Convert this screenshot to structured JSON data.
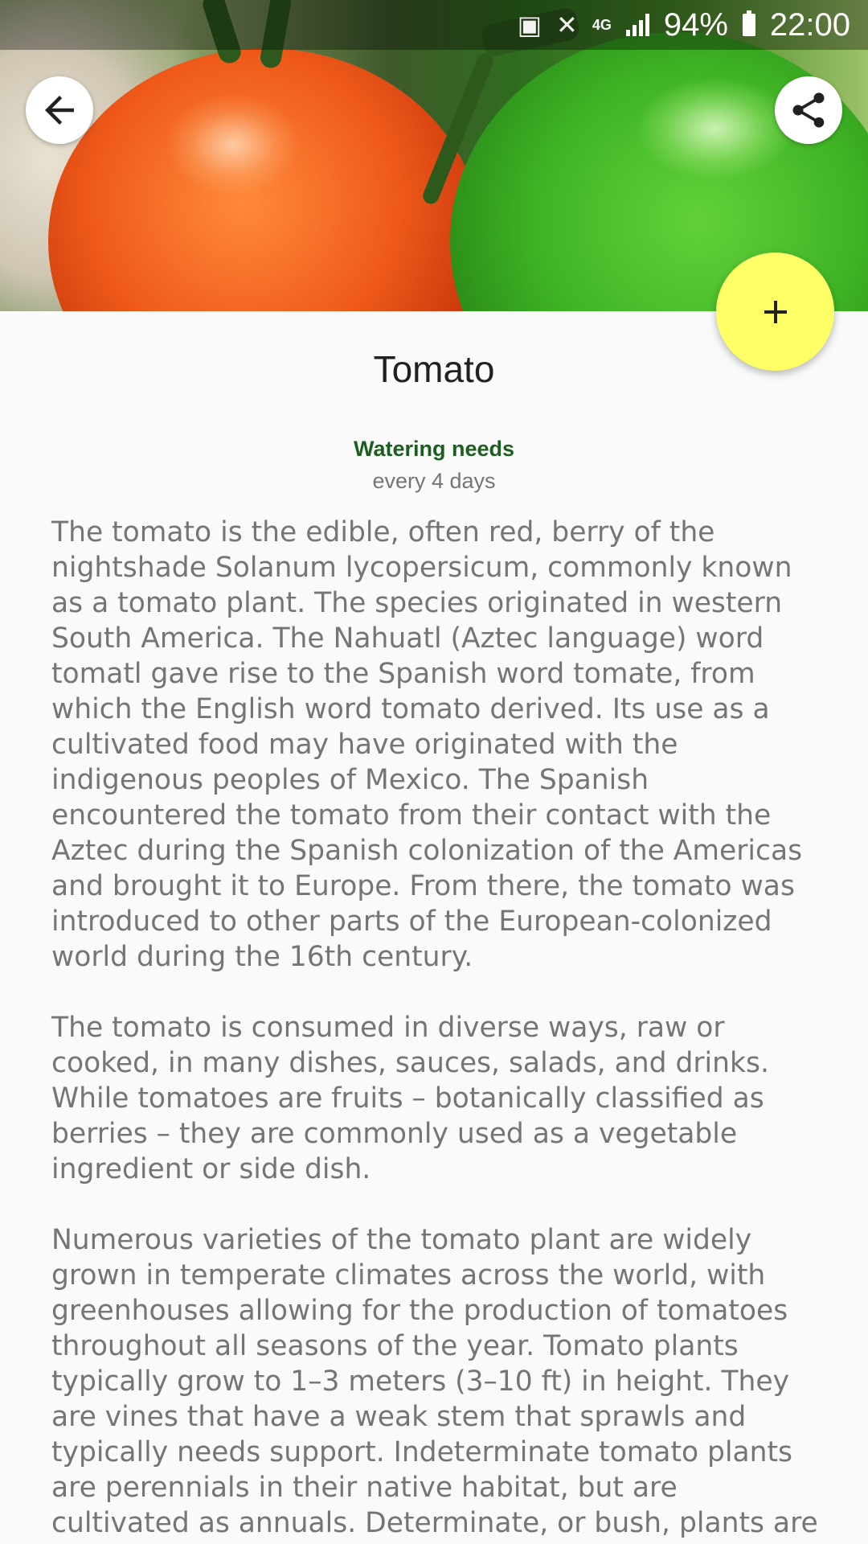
{
  "status_bar": {
    "network": "4G",
    "battery": "94%",
    "time": "22:00"
  },
  "header": {
    "back_icon": "arrow-left-icon",
    "share_icon": "share-icon",
    "add_icon": "plus-icon"
  },
  "plant": {
    "name": "Tomato",
    "watering_label": "Watering needs",
    "watering_value": "every 4 days",
    "description": "The tomato is the edible, often red, berry of the nightshade Solanum lycopersicum, commonly known as a tomato plant. The species originated in western South America. The Nahuatl (Aztec language) word tomatl gave rise to the Spanish word tomate, from which the English word tomato derived. Its use as a cultivated food may have originated with the indigenous peoples of Mexico. The Spanish encountered the tomato from their contact with the Aztec during the Spanish colonization of the Americas and brought it to Europe. From there, the tomato was introduced to other parts of the European-colonized world during the 16th century.\n\nThe tomato is consumed in diverse ways, raw or cooked, in many dishes, sauces, salads, and drinks. While tomatoes are fruits – botanically classified as berries – they are commonly used as a vegetable ingredient or side dish.\n\nNumerous varieties of the tomato plant are widely grown in temperate climates across the world, with greenhouses allowing for the production of tomatoes throughout all seasons of the year. Tomato plants typically grow to 1–3 meters (3–10 ft) in height. They are vines that have a weak stem that sprawls and typically needs support. Indeterminate tomato plants are perennials in their native habitat, but are cultivated as annuals. Determinate, or bush, plants are annuals"
  },
  "colors": {
    "fab": "#ffff66",
    "watering_label": "#1b5e20",
    "body_text": "#757575",
    "title": "#212121",
    "background": "#fafafa"
  }
}
